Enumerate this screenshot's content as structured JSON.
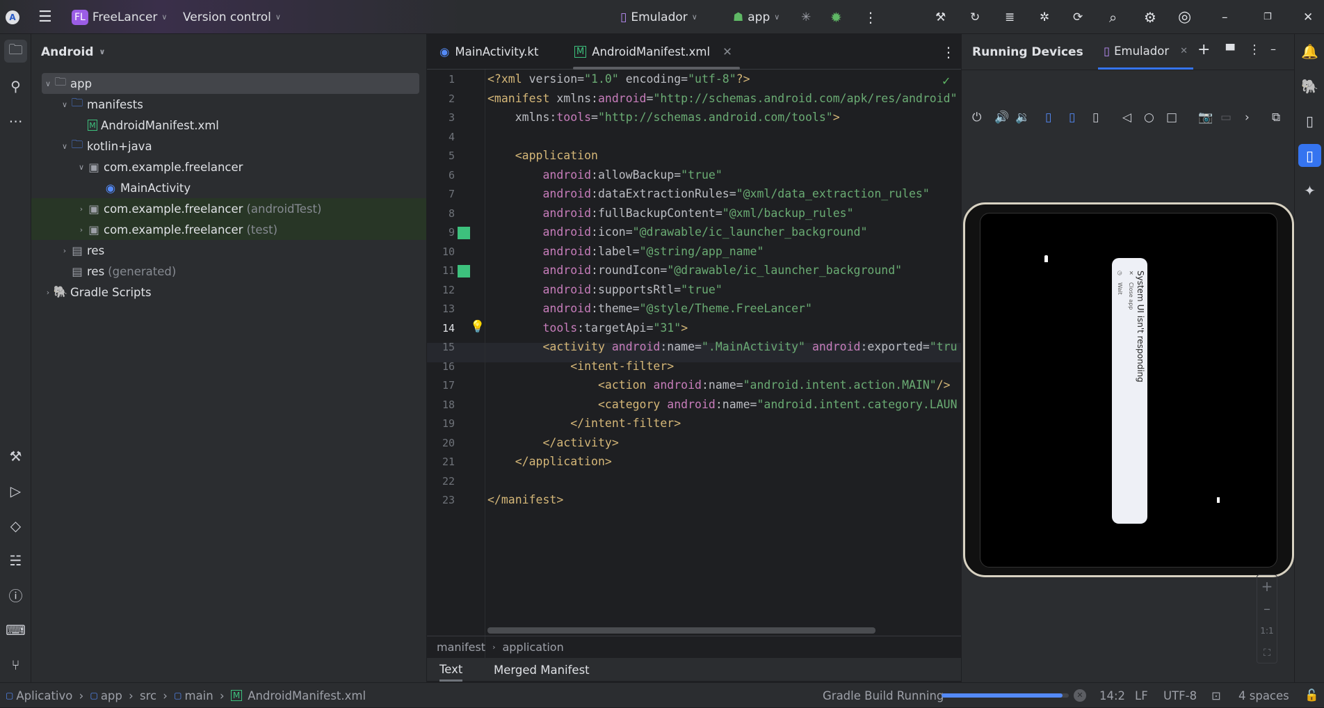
{
  "titlebar": {
    "project_badge": "FL",
    "project": "FreeLancer",
    "vcs": "Version control",
    "device": "Emulador",
    "run_config": "app"
  },
  "project_panel": {
    "view": "Android",
    "tree": [
      {
        "label": "app",
        "depth": 0,
        "arrow": "open",
        "icon": "module-folder-icon",
        "selected": true
      },
      {
        "label": "manifests",
        "depth": 1,
        "arrow": "open",
        "icon": "folder-icon"
      },
      {
        "label": "AndroidManifest.xml",
        "depth": 2,
        "arrow": "",
        "icon": "manifest-file-icon"
      },
      {
        "label": "kotlin+java",
        "depth": 1,
        "arrow": "open",
        "icon": "folder-icon"
      },
      {
        "label": "com.example.freelancer",
        "depth": 2,
        "arrow": "open",
        "icon": "package-icon"
      },
      {
        "label": "MainActivity",
        "depth": 3,
        "arrow": "",
        "icon": "kotlin-class-icon"
      },
      {
        "label": "com.example.freelancer",
        "suffix": "(androidTest)",
        "depth": 2,
        "arrow": "closed",
        "icon": "package-icon",
        "highlight": true
      },
      {
        "label": "com.example.freelancer",
        "suffix": "(test)",
        "depth": 2,
        "arrow": "closed",
        "icon": "package-icon",
        "highlight": true
      },
      {
        "label": "res",
        "depth": 1,
        "arrow": "closed",
        "icon": "res-folder-icon"
      },
      {
        "label": "res",
        "suffix": "(generated)",
        "depth": 1,
        "arrow": "",
        "icon": "res-folder-icon"
      },
      {
        "label": "Gradle Scripts",
        "depth": 0,
        "arrow": "closed",
        "icon": "gradle-icon"
      }
    ]
  },
  "editor": {
    "tabs": [
      {
        "label": "MainActivity.kt",
        "active": false
      },
      {
        "label": "AndroidManifest.xml",
        "active": true
      }
    ],
    "current_line": 14,
    "changed_lines": [
      9,
      11
    ],
    "lines": [
      [
        [
          "tag",
          "<?xml "
        ],
        [
          "attr",
          "version="
        ],
        [
          "val",
          "\"1.0\""
        ],
        [
          "attr",
          " encoding="
        ],
        [
          "val",
          "\"utf-8\""
        ],
        [
          "tag",
          "?>"
        ]
      ],
      [
        [
          "tag",
          "<manifest "
        ],
        [
          "attr",
          "xmlns:"
        ],
        [
          "ns",
          "android"
        ],
        [
          "attr",
          "="
        ],
        [
          "val",
          "\"http://schemas.android.com/apk/res/android\""
        ]
      ],
      [
        [
          "plain",
          "    "
        ],
        [
          "attr",
          "xmlns:"
        ],
        [
          "ns",
          "tools"
        ],
        [
          "attr",
          "="
        ],
        [
          "val",
          "\"http://schemas.android.com/tools\""
        ],
        [
          "tag",
          ">"
        ]
      ],
      [],
      [
        [
          "plain",
          "    "
        ],
        [
          "tag",
          "<application"
        ]
      ],
      [
        [
          "plain",
          "        "
        ],
        [
          "ns",
          "android"
        ],
        [
          "attr",
          ":allowBackup="
        ],
        [
          "val",
          "\"true\""
        ]
      ],
      [
        [
          "plain",
          "        "
        ],
        [
          "ns",
          "android"
        ],
        [
          "attr",
          ":dataExtractionRules="
        ],
        [
          "val",
          "\"@xml/data_extraction_rules\""
        ]
      ],
      [
        [
          "plain",
          "        "
        ],
        [
          "ns",
          "android"
        ],
        [
          "attr",
          ":fullBackupContent="
        ],
        [
          "val",
          "\"@xml/backup_rules\""
        ]
      ],
      [
        [
          "plain",
          "        "
        ],
        [
          "ns",
          "android"
        ],
        [
          "attr",
          ":icon="
        ],
        [
          "val",
          "\"@drawable/ic_launcher_background\""
        ]
      ],
      [
        [
          "plain",
          "        "
        ],
        [
          "ns",
          "android"
        ],
        [
          "attr",
          ":label="
        ],
        [
          "val",
          "\"@string/app_name\""
        ]
      ],
      [
        [
          "plain",
          "        "
        ],
        [
          "ns",
          "android"
        ],
        [
          "attr",
          ":roundIcon="
        ],
        [
          "val",
          "\"@drawable/ic_launcher_background\""
        ]
      ],
      [
        [
          "plain",
          "        "
        ],
        [
          "ns",
          "android"
        ],
        [
          "attr",
          ":supportsRtl="
        ],
        [
          "val",
          "\"true\""
        ]
      ],
      [
        [
          "plain",
          "        "
        ],
        [
          "ns",
          "android"
        ],
        [
          "attr",
          ":theme="
        ],
        [
          "val",
          "\"@style/Theme.FreeLancer\""
        ]
      ],
      [
        [
          "plain",
          "        "
        ],
        [
          "ns",
          "tools"
        ],
        [
          "attr",
          ":targetApi="
        ],
        [
          "val",
          "\"31\""
        ],
        [
          "tag",
          ">"
        ]
      ],
      [
        [
          "plain",
          "        "
        ],
        [
          "tag",
          "<activity "
        ],
        [
          "ns",
          "android"
        ],
        [
          "attr",
          ":name="
        ],
        [
          "val",
          "\".MainActivity\""
        ],
        [
          "attr",
          " "
        ],
        [
          "ns",
          "android"
        ],
        [
          "attr",
          ":exported="
        ],
        [
          "val",
          "\"tru"
        ]
      ],
      [
        [
          "plain",
          "            "
        ],
        [
          "tag",
          "<intent-filter>"
        ]
      ],
      [
        [
          "plain",
          "                "
        ],
        [
          "tag",
          "<action "
        ],
        [
          "ns",
          "android"
        ],
        [
          "attr",
          ":name="
        ],
        [
          "val",
          "\"android.intent.action.MAIN\""
        ],
        [
          "tag",
          "/>"
        ]
      ],
      [
        [
          "plain",
          "                "
        ],
        [
          "tag",
          "<category "
        ],
        [
          "ns",
          "android"
        ],
        [
          "attr",
          ":name="
        ],
        [
          "val",
          "\"android.intent.category.LAUN"
        ]
      ],
      [
        [
          "plain",
          "            "
        ],
        [
          "tag",
          "</intent-filter>"
        ]
      ],
      [
        [
          "plain",
          "        "
        ],
        [
          "tag",
          "</activity>"
        ]
      ],
      [
        [
          "plain",
          "    "
        ],
        [
          "tag",
          "</application>"
        ]
      ],
      [],
      [
        [
          "tag",
          "</manifest>"
        ]
      ]
    ],
    "breadcrumb": [
      "manifest",
      "application"
    ],
    "bottom_tabs": [
      {
        "label": "Text",
        "active": true
      },
      {
        "label": "Merged Manifest",
        "active": false
      }
    ]
  },
  "devices": {
    "title": "Running Devices",
    "tab": "Emulador",
    "dialog": {
      "title": "System UI isn't responding",
      "close": "Close app",
      "wait": "Wait"
    },
    "zoom_ratio": "1:1"
  },
  "status": {
    "path": [
      "Aplicativo",
      "app",
      "src",
      "main",
      "AndroidManifest.xml"
    ],
    "task": "Gradle Build Running",
    "progress": 0.95,
    "position": "14:2",
    "line_sep": "LF",
    "encoding": "UTF-8",
    "indent": "4 spaces"
  },
  "colors": {
    "accent": "#3574f0",
    "progress": "#548af7",
    "badge": "#9b5de5",
    "changed": "#3dc17d"
  }
}
